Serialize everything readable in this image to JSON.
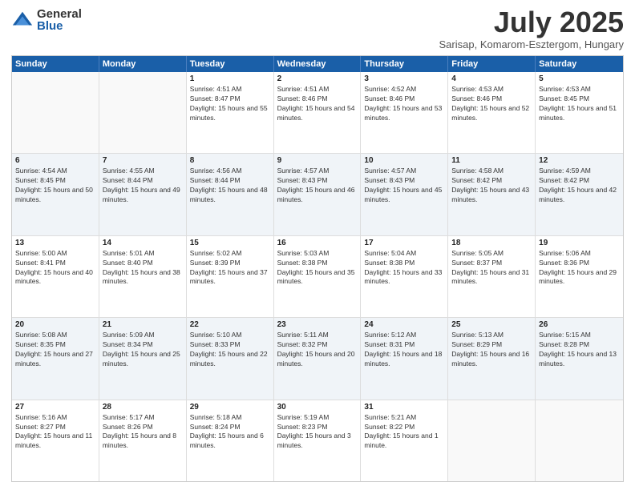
{
  "logo": {
    "general": "General",
    "blue": "Blue"
  },
  "header": {
    "month_year": "July 2025",
    "location": "Sarisap, Komarom-Esztergom, Hungary"
  },
  "days_of_week": [
    "Sunday",
    "Monday",
    "Tuesday",
    "Wednesday",
    "Thursday",
    "Friday",
    "Saturday"
  ],
  "rows": [
    [
      {
        "day": "",
        "sunrise": "",
        "sunset": "",
        "daylight": "",
        "empty": true
      },
      {
        "day": "",
        "sunrise": "",
        "sunset": "",
        "daylight": "",
        "empty": true
      },
      {
        "day": "1",
        "sunrise": "Sunrise: 4:51 AM",
        "sunset": "Sunset: 8:47 PM",
        "daylight": "Daylight: 15 hours and 55 minutes."
      },
      {
        "day": "2",
        "sunrise": "Sunrise: 4:51 AM",
        "sunset": "Sunset: 8:46 PM",
        "daylight": "Daylight: 15 hours and 54 minutes."
      },
      {
        "day": "3",
        "sunrise": "Sunrise: 4:52 AM",
        "sunset": "Sunset: 8:46 PM",
        "daylight": "Daylight: 15 hours and 53 minutes."
      },
      {
        "day": "4",
        "sunrise": "Sunrise: 4:53 AM",
        "sunset": "Sunset: 8:46 PM",
        "daylight": "Daylight: 15 hours and 52 minutes."
      },
      {
        "day": "5",
        "sunrise": "Sunrise: 4:53 AM",
        "sunset": "Sunset: 8:45 PM",
        "daylight": "Daylight: 15 hours and 51 minutes."
      }
    ],
    [
      {
        "day": "6",
        "sunrise": "Sunrise: 4:54 AM",
        "sunset": "Sunset: 8:45 PM",
        "daylight": "Daylight: 15 hours and 50 minutes."
      },
      {
        "day": "7",
        "sunrise": "Sunrise: 4:55 AM",
        "sunset": "Sunset: 8:44 PM",
        "daylight": "Daylight: 15 hours and 49 minutes."
      },
      {
        "day": "8",
        "sunrise": "Sunrise: 4:56 AM",
        "sunset": "Sunset: 8:44 PM",
        "daylight": "Daylight: 15 hours and 48 minutes."
      },
      {
        "day": "9",
        "sunrise": "Sunrise: 4:57 AM",
        "sunset": "Sunset: 8:43 PM",
        "daylight": "Daylight: 15 hours and 46 minutes."
      },
      {
        "day": "10",
        "sunrise": "Sunrise: 4:57 AM",
        "sunset": "Sunset: 8:43 PM",
        "daylight": "Daylight: 15 hours and 45 minutes."
      },
      {
        "day": "11",
        "sunrise": "Sunrise: 4:58 AM",
        "sunset": "Sunset: 8:42 PM",
        "daylight": "Daylight: 15 hours and 43 minutes."
      },
      {
        "day": "12",
        "sunrise": "Sunrise: 4:59 AM",
        "sunset": "Sunset: 8:42 PM",
        "daylight": "Daylight: 15 hours and 42 minutes."
      }
    ],
    [
      {
        "day": "13",
        "sunrise": "Sunrise: 5:00 AM",
        "sunset": "Sunset: 8:41 PM",
        "daylight": "Daylight: 15 hours and 40 minutes."
      },
      {
        "day": "14",
        "sunrise": "Sunrise: 5:01 AM",
        "sunset": "Sunset: 8:40 PM",
        "daylight": "Daylight: 15 hours and 38 minutes."
      },
      {
        "day": "15",
        "sunrise": "Sunrise: 5:02 AM",
        "sunset": "Sunset: 8:39 PM",
        "daylight": "Daylight: 15 hours and 37 minutes."
      },
      {
        "day": "16",
        "sunrise": "Sunrise: 5:03 AM",
        "sunset": "Sunset: 8:38 PM",
        "daylight": "Daylight: 15 hours and 35 minutes."
      },
      {
        "day": "17",
        "sunrise": "Sunrise: 5:04 AM",
        "sunset": "Sunset: 8:38 PM",
        "daylight": "Daylight: 15 hours and 33 minutes."
      },
      {
        "day": "18",
        "sunrise": "Sunrise: 5:05 AM",
        "sunset": "Sunset: 8:37 PM",
        "daylight": "Daylight: 15 hours and 31 minutes."
      },
      {
        "day": "19",
        "sunrise": "Sunrise: 5:06 AM",
        "sunset": "Sunset: 8:36 PM",
        "daylight": "Daylight: 15 hours and 29 minutes."
      }
    ],
    [
      {
        "day": "20",
        "sunrise": "Sunrise: 5:08 AM",
        "sunset": "Sunset: 8:35 PM",
        "daylight": "Daylight: 15 hours and 27 minutes."
      },
      {
        "day": "21",
        "sunrise": "Sunrise: 5:09 AM",
        "sunset": "Sunset: 8:34 PM",
        "daylight": "Daylight: 15 hours and 25 minutes."
      },
      {
        "day": "22",
        "sunrise": "Sunrise: 5:10 AM",
        "sunset": "Sunset: 8:33 PM",
        "daylight": "Daylight: 15 hours and 22 minutes."
      },
      {
        "day": "23",
        "sunrise": "Sunrise: 5:11 AM",
        "sunset": "Sunset: 8:32 PM",
        "daylight": "Daylight: 15 hours and 20 minutes."
      },
      {
        "day": "24",
        "sunrise": "Sunrise: 5:12 AM",
        "sunset": "Sunset: 8:31 PM",
        "daylight": "Daylight: 15 hours and 18 minutes."
      },
      {
        "day": "25",
        "sunrise": "Sunrise: 5:13 AM",
        "sunset": "Sunset: 8:29 PM",
        "daylight": "Daylight: 15 hours and 16 minutes."
      },
      {
        "day": "26",
        "sunrise": "Sunrise: 5:15 AM",
        "sunset": "Sunset: 8:28 PM",
        "daylight": "Daylight: 15 hours and 13 minutes."
      }
    ],
    [
      {
        "day": "27",
        "sunrise": "Sunrise: 5:16 AM",
        "sunset": "Sunset: 8:27 PM",
        "daylight": "Daylight: 15 hours and 11 minutes."
      },
      {
        "day": "28",
        "sunrise": "Sunrise: 5:17 AM",
        "sunset": "Sunset: 8:26 PM",
        "daylight": "Daylight: 15 hours and 8 minutes."
      },
      {
        "day": "29",
        "sunrise": "Sunrise: 5:18 AM",
        "sunset": "Sunset: 8:24 PM",
        "daylight": "Daylight: 15 hours and 6 minutes."
      },
      {
        "day": "30",
        "sunrise": "Sunrise: 5:19 AM",
        "sunset": "Sunset: 8:23 PM",
        "daylight": "Daylight: 15 hours and 3 minutes."
      },
      {
        "day": "31",
        "sunrise": "Sunrise: 5:21 AM",
        "sunset": "Sunset: 8:22 PM",
        "daylight": "Daylight: 15 hours and 1 minute."
      },
      {
        "day": "",
        "sunrise": "",
        "sunset": "",
        "daylight": "",
        "empty": true
      },
      {
        "day": "",
        "sunrise": "",
        "sunset": "",
        "daylight": "",
        "empty": true
      }
    ]
  ]
}
